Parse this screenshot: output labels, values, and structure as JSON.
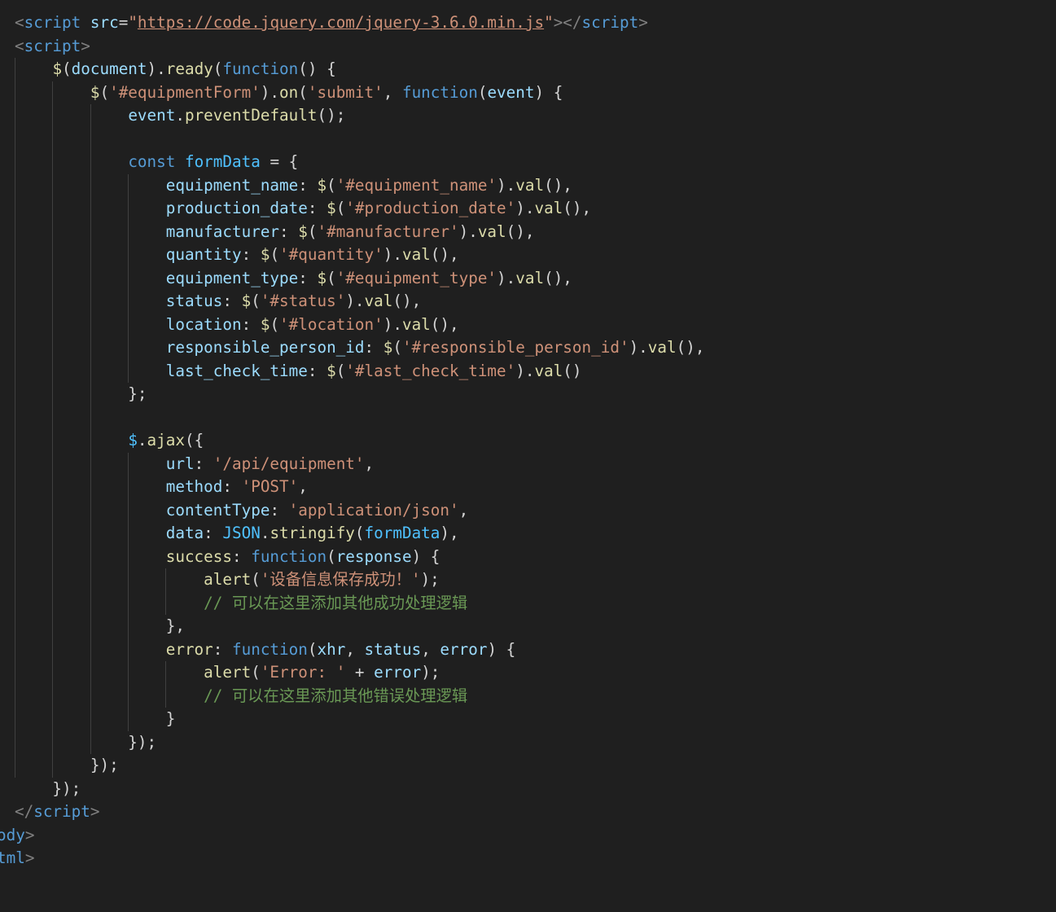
{
  "editor": {
    "language": "html",
    "theme": "dark",
    "lines": [
      [
        {
          "c": "t",
          "t": "<"
        },
        {
          "c": "tg",
          "t": "script"
        },
        {
          "c": "p",
          "t": " "
        },
        {
          "c": "at",
          "t": "src"
        },
        {
          "c": "p",
          "t": "="
        },
        {
          "c": "s",
          "t": "\""
        },
        {
          "c": "s u",
          "t": "https://code.jquery.com/jquery-3.6.0.min.js"
        },
        {
          "c": "s",
          "t": "\""
        },
        {
          "c": "t",
          "t": "></"
        },
        {
          "c": "tg",
          "t": "script"
        },
        {
          "c": "t",
          "t": ">"
        }
      ],
      [
        {
          "c": "t",
          "t": "<"
        },
        {
          "c": "tg",
          "t": "script"
        },
        {
          "c": "t",
          "t": ">"
        }
      ],
      [
        {
          "c": "p",
          "t": "    "
        },
        {
          "c": "f",
          "t": "$"
        },
        {
          "c": "p",
          "t": "("
        },
        {
          "c": "v",
          "t": "document"
        },
        {
          "c": "p",
          "t": ")."
        },
        {
          "c": "f",
          "t": "ready"
        },
        {
          "c": "p",
          "t": "("
        },
        {
          "c": "k",
          "t": "function"
        },
        {
          "c": "p",
          "t": "() {"
        }
      ],
      [
        {
          "c": "p",
          "t": "        "
        },
        {
          "c": "f",
          "t": "$"
        },
        {
          "c": "p",
          "t": "("
        },
        {
          "c": "s",
          "t": "'#equipmentForm'"
        },
        {
          "c": "p",
          "t": ")."
        },
        {
          "c": "f",
          "t": "on"
        },
        {
          "c": "p",
          "t": "("
        },
        {
          "c": "s",
          "t": "'submit'"
        },
        {
          "c": "p",
          "t": ", "
        },
        {
          "c": "k",
          "t": "function"
        },
        {
          "c": "p",
          "t": "("
        },
        {
          "c": "v",
          "t": "event"
        },
        {
          "c": "p",
          "t": ") {"
        }
      ],
      [
        {
          "c": "p",
          "t": "            "
        },
        {
          "c": "v",
          "t": "event"
        },
        {
          "c": "p",
          "t": "."
        },
        {
          "c": "f",
          "t": "preventDefault"
        },
        {
          "c": "p",
          "t": "();"
        }
      ],
      [],
      [
        {
          "c": "p",
          "t": "            "
        },
        {
          "c": "k",
          "t": "const"
        },
        {
          "c": "p",
          "t": " "
        },
        {
          "c": "co",
          "t": "formData"
        },
        {
          "c": "p",
          "t": " = {"
        }
      ],
      [
        {
          "c": "p",
          "t": "                "
        },
        {
          "c": "v",
          "t": "equipment_name"
        },
        {
          "c": "p",
          "t": ": "
        },
        {
          "c": "f",
          "t": "$"
        },
        {
          "c": "p",
          "t": "("
        },
        {
          "c": "s",
          "t": "'#equipment_name'"
        },
        {
          "c": "p",
          "t": ")."
        },
        {
          "c": "f",
          "t": "val"
        },
        {
          "c": "p",
          "t": "(),"
        }
      ],
      [
        {
          "c": "p",
          "t": "                "
        },
        {
          "c": "v",
          "t": "production_date"
        },
        {
          "c": "p",
          "t": ": "
        },
        {
          "c": "f",
          "t": "$"
        },
        {
          "c": "p",
          "t": "("
        },
        {
          "c": "s",
          "t": "'#production_date'"
        },
        {
          "c": "p",
          "t": ")."
        },
        {
          "c": "f",
          "t": "val"
        },
        {
          "c": "p",
          "t": "(),"
        }
      ],
      [
        {
          "c": "p",
          "t": "                "
        },
        {
          "c": "v",
          "t": "manufacturer"
        },
        {
          "c": "p",
          "t": ": "
        },
        {
          "c": "f",
          "t": "$"
        },
        {
          "c": "p",
          "t": "("
        },
        {
          "c": "s",
          "t": "'#manufacturer'"
        },
        {
          "c": "p",
          "t": ")."
        },
        {
          "c": "f",
          "t": "val"
        },
        {
          "c": "p",
          "t": "(),"
        }
      ],
      [
        {
          "c": "p",
          "t": "                "
        },
        {
          "c": "v",
          "t": "quantity"
        },
        {
          "c": "p",
          "t": ": "
        },
        {
          "c": "f",
          "t": "$"
        },
        {
          "c": "p",
          "t": "("
        },
        {
          "c": "s",
          "t": "'#quantity'"
        },
        {
          "c": "p",
          "t": ")."
        },
        {
          "c": "f",
          "t": "val"
        },
        {
          "c": "p",
          "t": "(),"
        }
      ],
      [
        {
          "c": "p",
          "t": "                "
        },
        {
          "c": "v",
          "t": "equipment_type"
        },
        {
          "c": "p",
          "t": ": "
        },
        {
          "c": "f",
          "t": "$"
        },
        {
          "c": "p",
          "t": "("
        },
        {
          "c": "s",
          "t": "'#equipment_type'"
        },
        {
          "c": "p",
          "t": ")."
        },
        {
          "c": "f",
          "t": "val"
        },
        {
          "c": "p",
          "t": "(),"
        }
      ],
      [
        {
          "c": "p",
          "t": "                "
        },
        {
          "c": "v",
          "t": "status"
        },
        {
          "c": "p",
          "t": ": "
        },
        {
          "c": "f",
          "t": "$"
        },
        {
          "c": "p",
          "t": "("
        },
        {
          "c": "s",
          "t": "'#status'"
        },
        {
          "c": "p",
          "t": ")."
        },
        {
          "c": "f",
          "t": "val"
        },
        {
          "c": "p",
          "t": "(),"
        }
      ],
      [
        {
          "c": "p",
          "t": "                "
        },
        {
          "c": "v",
          "t": "location"
        },
        {
          "c": "p",
          "t": ": "
        },
        {
          "c": "f",
          "t": "$"
        },
        {
          "c": "p",
          "t": "("
        },
        {
          "c": "s",
          "t": "'#location'"
        },
        {
          "c": "p",
          "t": ")."
        },
        {
          "c": "f",
          "t": "val"
        },
        {
          "c": "p",
          "t": "(),"
        }
      ],
      [
        {
          "c": "p",
          "t": "                "
        },
        {
          "c": "v",
          "t": "responsible_person_id"
        },
        {
          "c": "p",
          "t": ": "
        },
        {
          "c": "f",
          "t": "$"
        },
        {
          "c": "p",
          "t": "("
        },
        {
          "c": "s",
          "t": "'#responsible_person_id'"
        },
        {
          "c": "p",
          "t": ")."
        },
        {
          "c": "f",
          "t": "val"
        },
        {
          "c": "p",
          "t": "(),"
        }
      ],
      [
        {
          "c": "p",
          "t": "                "
        },
        {
          "c": "v",
          "t": "last_check_time"
        },
        {
          "c": "p",
          "t": ": "
        },
        {
          "c": "f",
          "t": "$"
        },
        {
          "c": "p",
          "t": "("
        },
        {
          "c": "s",
          "t": "'#last_check_time'"
        },
        {
          "c": "p",
          "t": ")."
        },
        {
          "c": "f",
          "t": "val"
        },
        {
          "c": "p",
          "t": "()"
        }
      ],
      [
        {
          "c": "p",
          "t": "            };"
        }
      ],
      [],
      [
        {
          "c": "p",
          "t": "            "
        },
        {
          "c": "co",
          "t": "$"
        },
        {
          "c": "p",
          "t": "."
        },
        {
          "c": "f",
          "t": "ajax"
        },
        {
          "c": "p",
          "t": "({"
        }
      ],
      [
        {
          "c": "p",
          "t": "                "
        },
        {
          "c": "v",
          "t": "url"
        },
        {
          "c": "p",
          "t": ": "
        },
        {
          "c": "s",
          "t": "'/api/equipment'"
        },
        {
          "c": "p",
          "t": ","
        }
      ],
      [
        {
          "c": "p",
          "t": "                "
        },
        {
          "c": "v",
          "t": "method"
        },
        {
          "c": "p",
          "t": ": "
        },
        {
          "c": "s",
          "t": "'POST'"
        },
        {
          "c": "p",
          "t": ","
        }
      ],
      [
        {
          "c": "p",
          "t": "                "
        },
        {
          "c": "v",
          "t": "contentType"
        },
        {
          "c": "p",
          "t": ": "
        },
        {
          "c": "s",
          "t": "'application/json'"
        },
        {
          "c": "p",
          "t": ","
        }
      ],
      [
        {
          "c": "p",
          "t": "                "
        },
        {
          "c": "v",
          "t": "data"
        },
        {
          "c": "p",
          "t": ": "
        },
        {
          "c": "co",
          "t": "JSON"
        },
        {
          "c": "p",
          "t": "."
        },
        {
          "c": "f",
          "t": "stringify"
        },
        {
          "c": "p",
          "t": "("
        },
        {
          "c": "co",
          "t": "formData"
        },
        {
          "c": "p",
          "t": "),"
        }
      ],
      [
        {
          "c": "p",
          "t": "                "
        },
        {
          "c": "f",
          "t": "success"
        },
        {
          "c": "p",
          "t": ": "
        },
        {
          "c": "k",
          "t": "function"
        },
        {
          "c": "p",
          "t": "("
        },
        {
          "c": "v",
          "t": "response"
        },
        {
          "c": "p",
          "t": ") {"
        }
      ],
      [
        {
          "c": "p",
          "t": "                    "
        },
        {
          "c": "f",
          "t": "alert"
        },
        {
          "c": "p",
          "t": "("
        },
        {
          "c": "s",
          "t": "'设备信息保存成功！'"
        },
        {
          "c": "p",
          "t": ");"
        }
      ],
      [
        {
          "c": "p",
          "t": "                    "
        },
        {
          "c": "c",
          "t": "// 可以在这里添加其他成功处理逻辑"
        }
      ],
      [
        {
          "c": "p",
          "t": "                },"
        }
      ],
      [
        {
          "c": "p",
          "t": "                "
        },
        {
          "c": "f",
          "t": "error"
        },
        {
          "c": "p",
          "t": ": "
        },
        {
          "c": "k",
          "t": "function"
        },
        {
          "c": "p",
          "t": "("
        },
        {
          "c": "v",
          "t": "xhr"
        },
        {
          "c": "p",
          "t": ", "
        },
        {
          "c": "v",
          "t": "status"
        },
        {
          "c": "p",
          "t": ", "
        },
        {
          "c": "v",
          "t": "error"
        },
        {
          "c": "p",
          "t": ") {"
        }
      ],
      [
        {
          "c": "p",
          "t": "                    "
        },
        {
          "c": "f",
          "t": "alert"
        },
        {
          "c": "p",
          "t": "("
        },
        {
          "c": "s",
          "t": "'Error: '"
        },
        {
          "c": "p",
          "t": " + "
        },
        {
          "c": "v",
          "t": "error"
        },
        {
          "c": "p",
          "t": ");"
        }
      ],
      [
        {
          "c": "p",
          "t": "                    "
        },
        {
          "c": "c",
          "t": "// 可以在这里添加其他错误处理逻辑"
        }
      ],
      [
        {
          "c": "p",
          "t": "                }"
        }
      ],
      [
        {
          "c": "p",
          "t": "            });"
        }
      ],
      [
        {
          "c": "p",
          "t": "        });"
        }
      ],
      [
        {
          "c": "p",
          "t": "    });"
        }
      ],
      [
        {
          "c": "t",
          "t": "</"
        },
        {
          "c": "tg",
          "t": "script"
        },
        {
          "c": "t",
          "t": ">"
        }
      ],
      [
        {
          "c": "tg",
          "t": "ody"
        },
        {
          "c": "t",
          "t": ">"
        }
      ],
      [
        {
          "c": "tg",
          "t": "tml"
        },
        {
          "c": "t",
          "t": ">"
        }
      ]
    ]
  }
}
